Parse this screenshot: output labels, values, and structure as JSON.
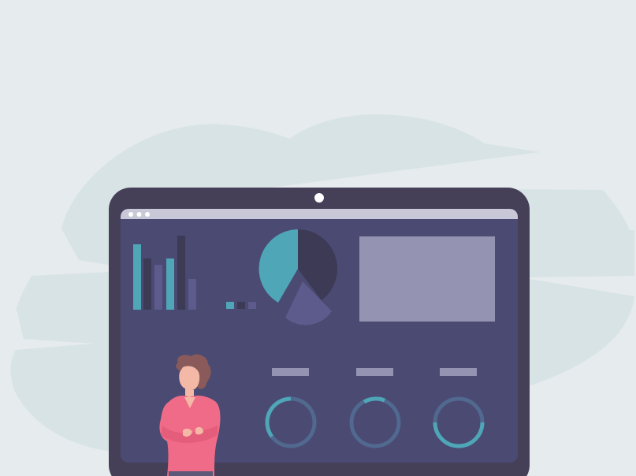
{
  "colors": {
    "background": "#e6ebed",
    "cloud": "#d8e3e6",
    "tablet_frame": "#453f57",
    "screen": "#4a4a73",
    "browser_bar": "#c9c8d9",
    "teal": "#4ea6b7",
    "dark": "#3c3a55",
    "muted": "#5d5a8c",
    "panel": "#9593b2",
    "label_bar": "#9593b2",
    "shirt": "#f06b87",
    "skin": "#f4b8a6",
    "hair": "#8a5a5a"
  },
  "illustration": {
    "subject": "person-presenting-dashboard",
    "bar_chart": {
      "series": [
        {
          "color": "teal",
          "value": 0.85
        },
        {
          "color": "dark",
          "value": 0.67
        },
        {
          "color": "muted",
          "value": 0.59
        },
        {
          "color": "teal",
          "value": 0.67
        },
        {
          "color": "dark",
          "value": 0.96
        },
        {
          "color": "muted",
          "value": 0.4
        }
      ]
    },
    "pie_chart": {
      "slices": [
        {
          "color": "dark",
          "fraction": 0.45
        },
        {
          "color": "muted",
          "fraction": 0.2
        },
        {
          "color": "teal",
          "fraction": 0.35
        }
      ]
    },
    "progress_rings": [
      {
        "fraction": 0.3
      },
      {
        "fraction": 0.08
      },
      {
        "fraction": 0.55
      }
    ],
    "window_dots": 3
  }
}
